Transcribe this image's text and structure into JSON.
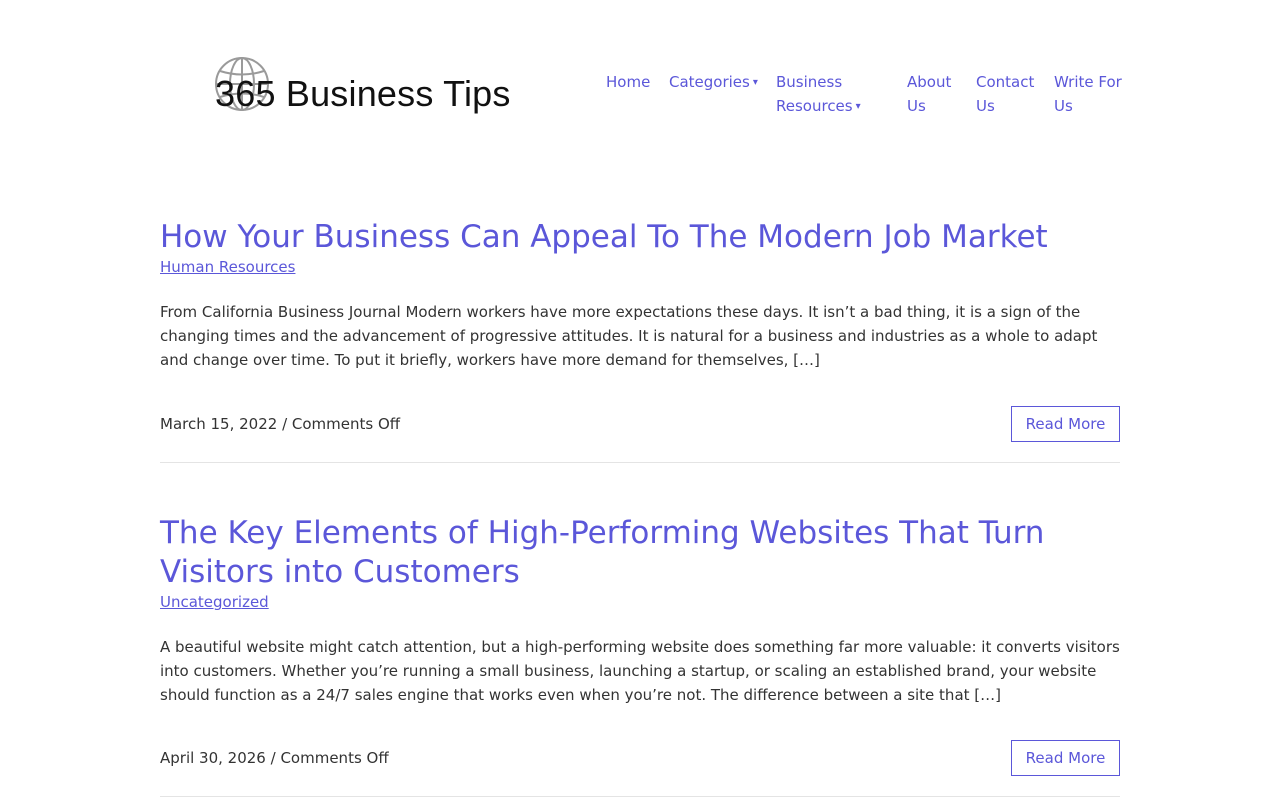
{
  "site": {
    "logo_text": "365 Business Tips",
    "logo_icon": "globe-icon"
  },
  "nav": {
    "home": "Home",
    "categories": "Categories",
    "business_resources_line1": "Business",
    "business_resources_line2": "Resources",
    "about_line1": "About",
    "about_line2": "Us",
    "contact_line1": "Contact",
    "contact_line2": "Us",
    "write_line1": "Write For",
    "write_line2": "Us",
    "caret": "▾"
  },
  "posts": [
    {
      "title": "How Your Business Can Appeal To The Modern Job Market",
      "category": "Human Resources",
      "excerpt": "From California Business Journal  Modern workers have more expectations these days. It isn’t a bad thing, it is a sign of the changing times and the advancement of progressive attitudes. It is natural for a business and industries as a whole to adapt and change over time. To put it briefly, workers have more demand for themselves, […]",
      "date": "March 15, 2022",
      "separator": " / ",
      "comments": "Comments Off",
      "read_more": "Read More"
    },
    {
      "title": "The Key Elements of High-Performing Websites That Turn Visitors into Customers",
      "category": "Uncategorized",
      "excerpt": "A beautiful website might catch attention, but a high-performing website does something far more valuable: it converts visitors into customers. Whether you’re running a small business, launching a startup, or scaling an established brand, your website should function as a 24/7 sales engine that works even when you’re not. The difference between a site that […]",
      "date": "April 30, 2026",
      "separator": " / ",
      "comments": "Comments Off",
      "read_more": "Read More"
    }
  ],
  "colors": {
    "accent": "#5b57d9",
    "text": "#333333",
    "divider": "#e4e4e4"
  }
}
